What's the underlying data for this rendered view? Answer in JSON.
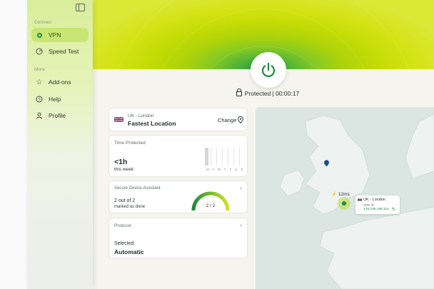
{
  "sidebar": {
    "section_connect": "Connect",
    "section_more": "More",
    "items": [
      {
        "label": "VPN",
        "icon": "vpn-icon"
      },
      {
        "label": "Speed Test",
        "icon": "speedometer-icon"
      },
      {
        "label": "Add-ons",
        "icon": "star-icon"
      },
      {
        "label": "Help",
        "icon": "help-icon"
      },
      {
        "label": "Profile",
        "icon": "person-icon"
      }
    ]
  },
  "status": {
    "text": "Protected | 00:00:17"
  },
  "location": {
    "region": "UK - London",
    "name": "Fastest Location",
    "change_label": "Change"
  },
  "time_protected": {
    "title": "Time Protected",
    "value": "<1h",
    "period": "this week",
    "days": [
      "M",
      "T",
      "W",
      "T",
      "F",
      "S",
      "S"
    ]
  },
  "assistant": {
    "title": "Secure Device Assistant",
    "count": "2 out of 2",
    "subtitle": "marked as done",
    "gauge": "2 / 2",
    "fraction": 1.0
  },
  "protocol": {
    "title": "Protocol",
    "selected_label": "Selected:",
    "value": "Automatic"
  },
  "map": {
    "latency": "12ms",
    "server_name": "UK - London",
    "vpn_ip_label": "VPN IP:",
    "vpn_ip": "178.239.199.114"
  },
  "colors": {
    "accent": "#c9e675",
    "brand_green": "#1f8a3c",
    "hero_lime": "#c4dc05"
  }
}
